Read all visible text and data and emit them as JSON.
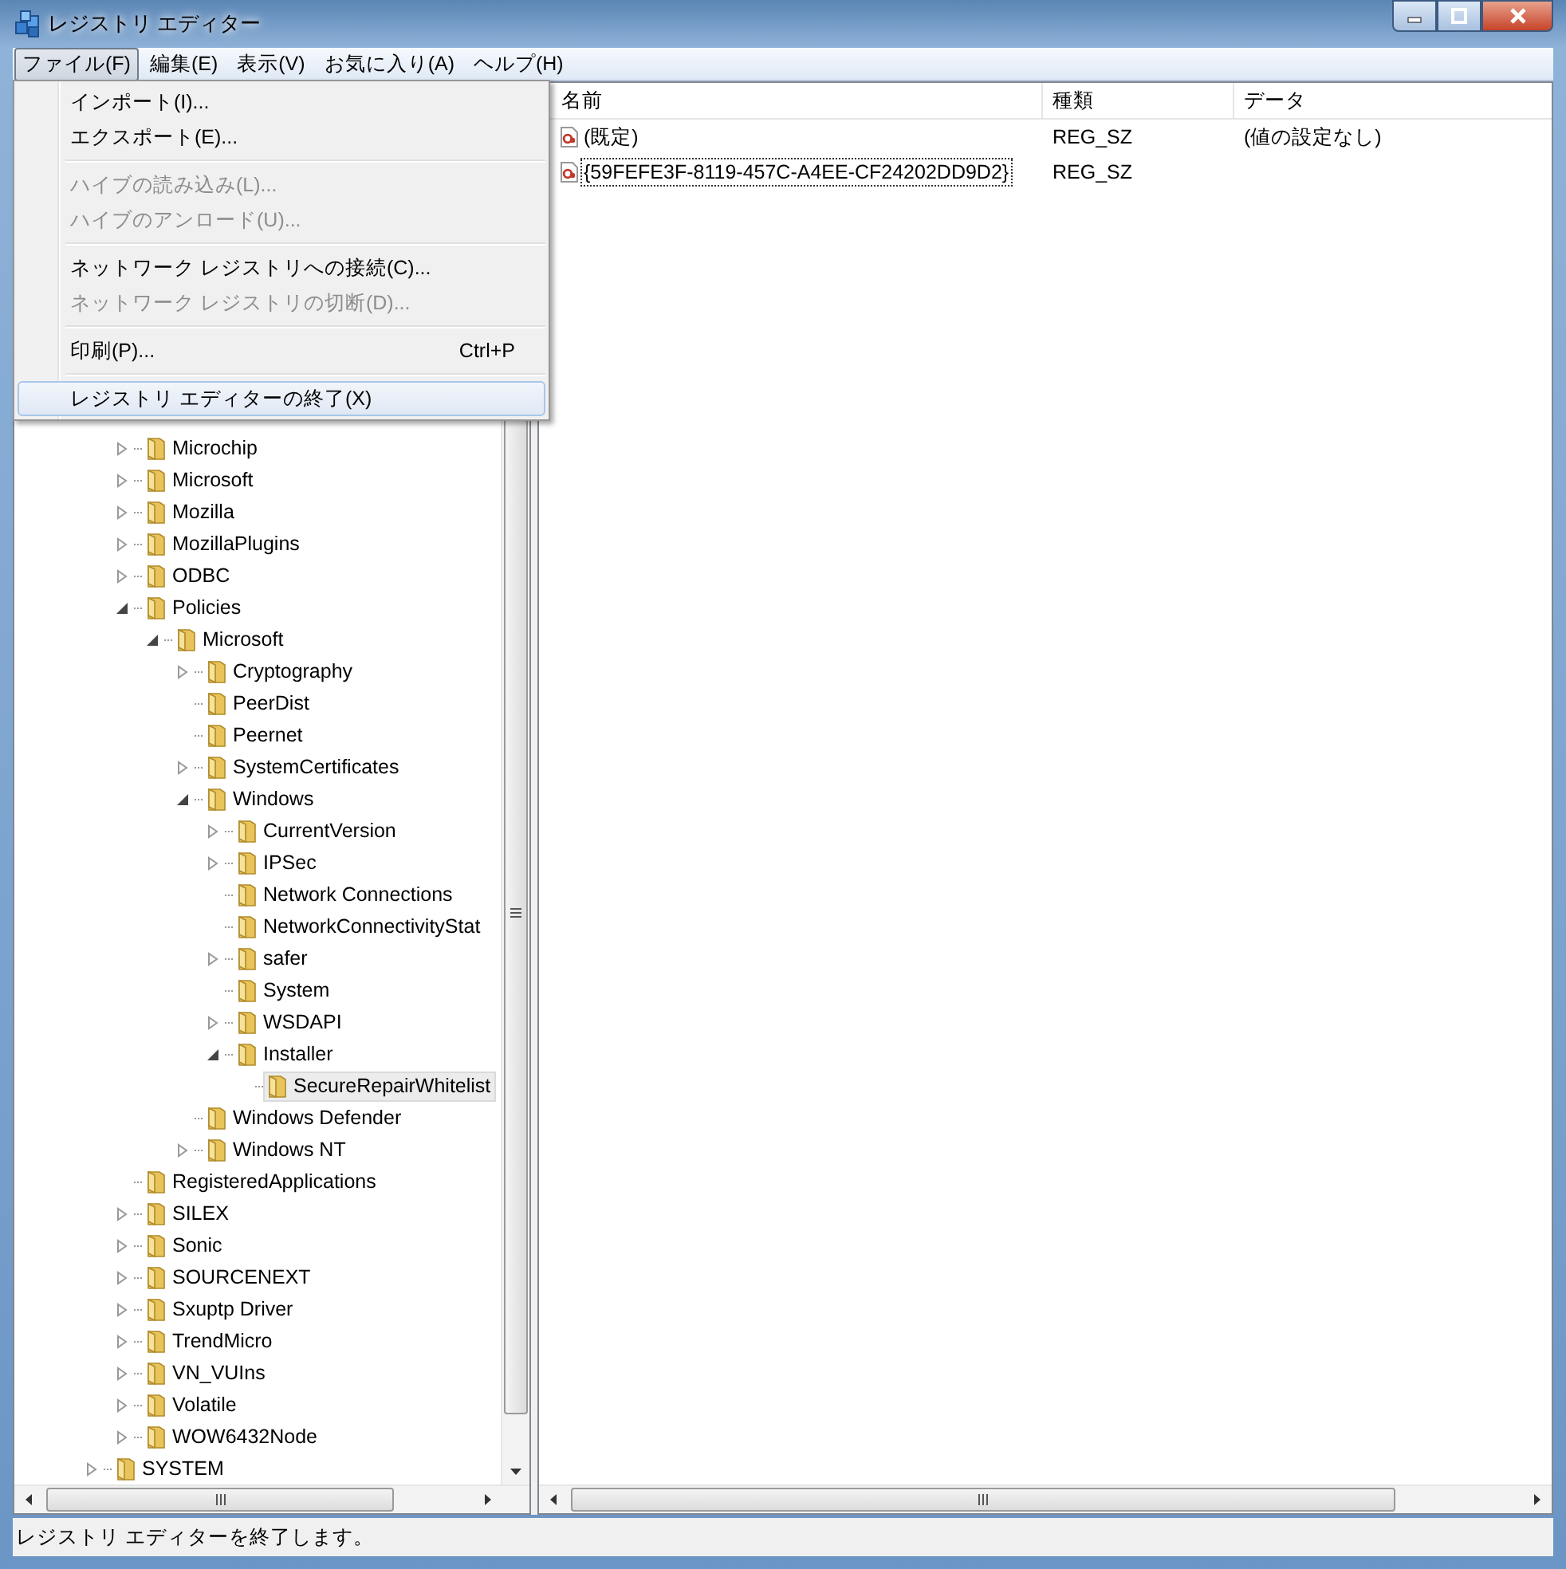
{
  "window": {
    "title": "レジストリ エディター"
  },
  "menu_bar": [
    {
      "label": "ファイル(F)",
      "selected": true
    },
    {
      "label": "編集(E)",
      "selected": false
    },
    {
      "label": "表示(V)",
      "selected": false
    },
    {
      "label": "お気に入り(A)",
      "selected": false
    },
    {
      "label": "ヘルプ(H)",
      "selected": false
    }
  ],
  "file_menu": [
    {
      "kind": "item",
      "label": "インポート(I)...",
      "disabled": false,
      "selected": false
    },
    {
      "kind": "item",
      "label": "エクスポート(E)...",
      "disabled": false,
      "selected": false
    },
    {
      "kind": "separator"
    },
    {
      "kind": "item",
      "label": "ハイブの読み込み(L)...",
      "disabled": true,
      "selected": false
    },
    {
      "kind": "item",
      "label": "ハイブのアンロード(U)...",
      "disabled": true,
      "selected": false
    },
    {
      "kind": "separator"
    },
    {
      "kind": "item",
      "label": "ネットワーク レジストリへの接続(C)...",
      "disabled": false,
      "selected": false
    },
    {
      "kind": "item",
      "label": "ネットワーク レジストリの切断(D)...",
      "disabled": true,
      "selected": false
    },
    {
      "kind": "separator"
    },
    {
      "kind": "item",
      "label": "印刷(P)...",
      "shortcut": "Ctrl+P",
      "disabled": false,
      "selected": false
    },
    {
      "kind": "separator"
    },
    {
      "kind": "item",
      "label": "レジストリ エディターの終了(X)",
      "disabled": false,
      "selected": true
    }
  ],
  "tree": [
    {
      "children": [
        {
          "label": "Microchip",
          "expandable": true,
          "selected": false
        },
        {
          "label": "Microsoft",
          "expandable": true,
          "selected": false
        },
        {
          "label": "Mozilla",
          "expandable": true,
          "selected": false
        },
        {
          "label": "MozillaPlugins",
          "expandable": true,
          "selected": false
        },
        {
          "label": "ODBC",
          "expandable": true,
          "selected": false
        },
        {
          "label": "Policies",
          "expandable": true,
          "selected": false,
          "children": [
            {
              "label": "Microsoft",
              "expandable": true,
              "selected": false,
              "children": [
                {
                  "label": "Cryptography",
                  "expandable": true,
                  "selected": false
                },
                {
                  "label": "PeerDist",
                  "expandable": false,
                  "selected": false
                },
                {
                  "label": "Peernet",
                  "expandable": false,
                  "selected": false
                },
                {
                  "label": "SystemCertificates",
                  "expandable": true,
                  "selected": false
                },
                {
                  "label": "Windows",
                  "expandable": true,
                  "selected": false,
                  "children": [
                    {
                      "label": "CurrentVersion",
                      "expandable": true,
                      "selected": false
                    },
                    {
                      "label": "IPSec",
                      "expandable": true,
                      "selected": false
                    },
                    {
                      "label": "Network Connections",
                      "expandable": false,
                      "selected": false
                    },
                    {
                      "label": "NetworkConnectivityStat",
                      "expandable": false,
                      "selected": false
                    },
                    {
                      "label": "safer",
                      "expandable": true,
                      "selected": false
                    },
                    {
                      "label": "System",
                      "expandable": false,
                      "selected": false
                    },
                    {
                      "label": "WSDAPI",
                      "expandable": true,
                      "selected": false
                    },
                    {
                      "label": "Installer",
                      "expandable": true,
                      "selected": false,
                      "children": [
                        {
                          "label": "SecureRepairWhitelist",
                          "expandable": false,
                          "selected": true
                        }
                      ]
                    }
                  ]
                },
                {
                  "label": "Windows Defender",
                  "expandable": false,
                  "selected": false
                },
                {
                  "label": "Windows NT",
                  "expandable": true,
                  "selected": false
                }
              ]
            }
          ]
        },
        {
          "label": "RegisteredApplications",
          "expandable": false,
          "selected": false
        },
        {
          "label": "SILEX",
          "expandable": true,
          "selected": false
        },
        {
          "label": "Sonic",
          "expandable": true,
          "selected": false
        },
        {
          "label": "SOURCENEXT",
          "expandable": true,
          "selected": false
        },
        {
          "label": "Sxuptp Driver",
          "expandable": true,
          "selected": false
        },
        {
          "label": "TrendMicro",
          "expandable": true,
          "selected": false
        },
        {
          "label": "VN_VUIns",
          "expandable": true,
          "selected": false
        },
        {
          "label": "Volatile",
          "expandable": true,
          "selected": false
        },
        {
          "label": "WOW6432Node",
          "expandable": true,
          "selected": false
        }
      ]
    },
    {
      "label": "SYSTEM",
      "expandable": true,
      "selected": false
    }
  ],
  "values": {
    "columns": [
      "名前",
      "種類",
      "データ"
    ],
    "rows": [
      {
        "name": "(既定)",
        "type": "REG_SZ",
        "data": "(値の設定なし)",
        "focused": false
      },
      {
        "name": "{59FEFE3F-8119-457C-A4EE-CF24202DD9D2}",
        "type": "REG_SZ",
        "focused": true
      }
    ]
  },
  "status_bar": "レジストリ エディターを終了します。"
}
